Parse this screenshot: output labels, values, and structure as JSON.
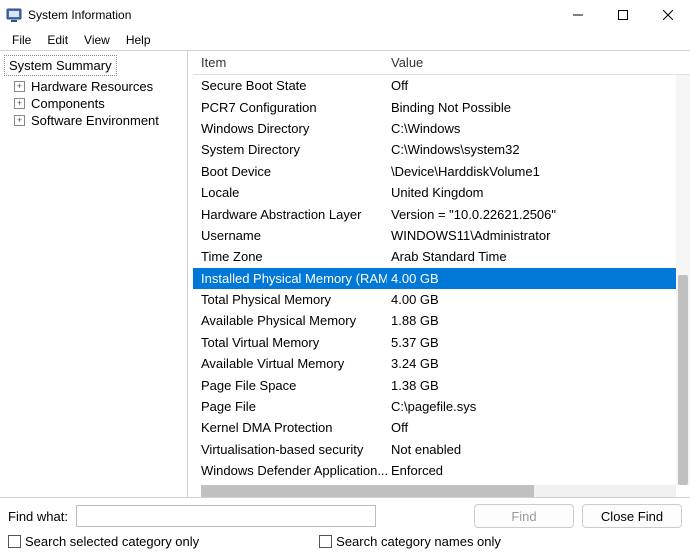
{
  "window": {
    "title": "System Information"
  },
  "menu": {
    "file": "File",
    "edit": "Edit",
    "view": "View",
    "help": "Help"
  },
  "tree": {
    "root": "System Summary",
    "items": [
      {
        "label": "Hardware Resources"
      },
      {
        "label": "Components"
      },
      {
        "label": "Software Environment"
      }
    ]
  },
  "columns": {
    "item": "Item",
    "value": "Value"
  },
  "rows": [
    {
      "item": "Secure Boot State",
      "value": "Off",
      "selected": false
    },
    {
      "item": "PCR7 Configuration",
      "value": "Binding Not Possible",
      "selected": false
    },
    {
      "item": "Windows Directory",
      "value": "C:\\Windows",
      "selected": false
    },
    {
      "item": "System Directory",
      "value": "C:\\Windows\\system32",
      "selected": false
    },
    {
      "item": "Boot Device",
      "value": "\\Device\\HarddiskVolume1",
      "selected": false
    },
    {
      "item": "Locale",
      "value": "United Kingdom",
      "selected": false
    },
    {
      "item": "Hardware Abstraction Layer",
      "value": "Version = \"10.0.22621.2506\"",
      "selected": false
    },
    {
      "item": "Username",
      "value": "WINDOWS11\\Administrator",
      "selected": false
    },
    {
      "item": "Time Zone",
      "value": "Arab Standard Time",
      "selected": false
    },
    {
      "item": "Installed Physical Memory (RAM)",
      "value": "4.00 GB",
      "selected": true
    },
    {
      "item": "Total Physical Memory",
      "value": "4.00 GB",
      "selected": false
    },
    {
      "item": "Available Physical Memory",
      "value": "1.88 GB",
      "selected": false
    },
    {
      "item": "Total Virtual Memory",
      "value": "5.37 GB",
      "selected": false
    },
    {
      "item": "Available Virtual Memory",
      "value": "3.24 GB",
      "selected": false
    },
    {
      "item": "Page File Space",
      "value": "1.38 GB",
      "selected": false
    },
    {
      "item": "Page File",
      "value": "C:\\pagefile.sys",
      "selected": false
    },
    {
      "item": "Kernel DMA Protection",
      "value": "Off",
      "selected": false
    },
    {
      "item": "Virtualisation-based security",
      "value": "Not enabled",
      "selected": false
    },
    {
      "item": "Windows Defender Application...",
      "value": "Enforced",
      "selected": false
    }
  ],
  "search": {
    "label": "Find what:",
    "input_value": "",
    "find_button": "Find",
    "close_button": "Close Find",
    "chk_selected": "Search selected category only",
    "chk_names": "Search category names only"
  }
}
